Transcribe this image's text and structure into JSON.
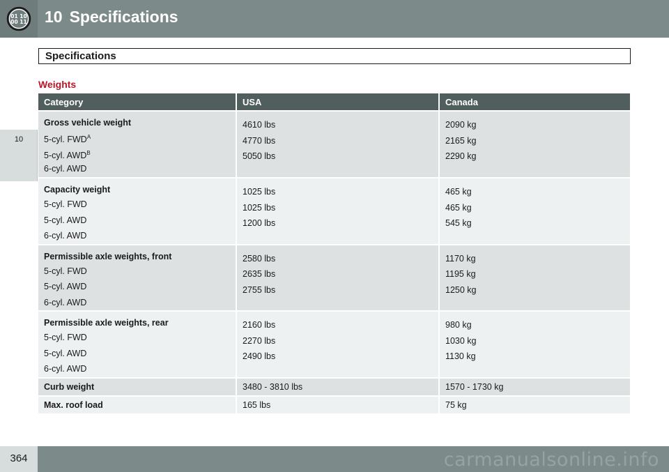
{
  "header": {
    "chapter_number": "10",
    "chapter_title": "Specifications",
    "icon": "odometer-icon",
    "icon_digits_top": "01 10",
    "icon_digits_bottom": "00 11"
  },
  "rail": {
    "chapter_tab": "10"
  },
  "section": {
    "title": "Specifications"
  },
  "weights_heading": "Weights",
  "table": {
    "columns": [
      "Category",
      "USA",
      "Canada"
    ],
    "groups": [
      {
        "title": "Gross vehicle weight",
        "rows": [
          {
            "label": "5-cyl. FWD",
            "sup": "A",
            "usa": "4610 lbs",
            "canada": "2090 kg"
          },
          {
            "label": "5-cyl. AWD",
            "sup": "B",
            "usa": "4770 lbs",
            "canada": "2165 kg"
          },
          {
            "label": "6-cyl. AWD",
            "sup": "",
            "usa": "5050 lbs",
            "canada": "2290 kg"
          }
        ]
      },
      {
        "title": "Capacity weight",
        "rows": [
          {
            "label": "5-cyl. FWD",
            "sup": "",
            "usa": "1025 lbs",
            "canada": "465 kg"
          },
          {
            "label": "5-cyl. AWD",
            "sup": "",
            "usa": "1025 lbs",
            "canada": "465 kg"
          },
          {
            "label": "6-cyl. AWD",
            "sup": "",
            "usa": "1200 lbs",
            "canada": "545 kg"
          }
        ]
      },
      {
        "title": "Permissible axle weights, front",
        "rows": [
          {
            "label": "5-cyl. FWD",
            "sup": "",
            "usa": "2580 lbs",
            "canada": "1170 kg"
          },
          {
            "label": "5-cyl. AWD",
            "sup": "",
            "usa": "2635 lbs",
            "canada": "1195 kg"
          },
          {
            "label": "6-cyl. AWD",
            "sup": "",
            "usa": "2755 lbs",
            "canada": "1250 kg"
          }
        ]
      },
      {
        "title": "Permissible axle weights, rear",
        "rows": [
          {
            "label": "5-cyl. FWD",
            "sup": "",
            "usa": "2160 lbs",
            "canada": "980 kg"
          },
          {
            "label": "5-cyl. AWD",
            "sup": "",
            "usa": "2270 lbs",
            "canada": "1030 kg"
          },
          {
            "label": "6-cyl. AWD",
            "sup": "",
            "usa": "2490 lbs",
            "canada": "1130 kg"
          }
        ]
      }
    ],
    "single_rows": [
      {
        "label": "Curb weight",
        "usa": "3480 - 3810 lbs",
        "canada": "1570 - 1730 kg"
      },
      {
        "label": "Max. roof load",
        "usa": "165 lbs",
        "canada": "75 kg"
      }
    ]
  },
  "footer": {
    "page_number": "364",
    "watermark": "carmanualsonline.info"
  },
  "colors": {
    "header_bg": "#7d8a8a",
    "table_header_bg": "#515e5e",
    "accent_red": "#b8172a",
    "row_dark": "#dde1e1",
    "row_light": "#eef1f2"
  }
}
